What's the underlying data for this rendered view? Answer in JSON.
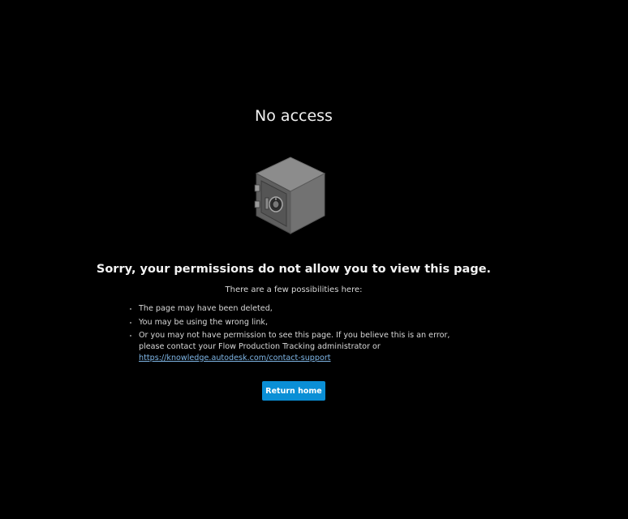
{
  "page": {
    "title": "No access"
  },
  "message": {
    "heading": "Sorry, your permissions do not allow you to view this page.",
    "subheading": "There are a few possibilities here:",
    "reasons": [
      "The page may have been deleted,",
      "You may be using the wrong link,",
      "Or you may not have permission to see this page. If you believe this is an error, please contact your Flow Production Tracking administrator or"
    ],
    "support_link": "https://knowledge.autodesk.com/contact-support"
  },
  "actions": {
    "return_home_label": "Return home"
  },
  "illustration": {
    "icon": "safe-icon"
  },
  "colors": {
    "background": "#000000",
    "accent": "#0a8fd6",
    "link": "#7fb6e6"
  }
}
